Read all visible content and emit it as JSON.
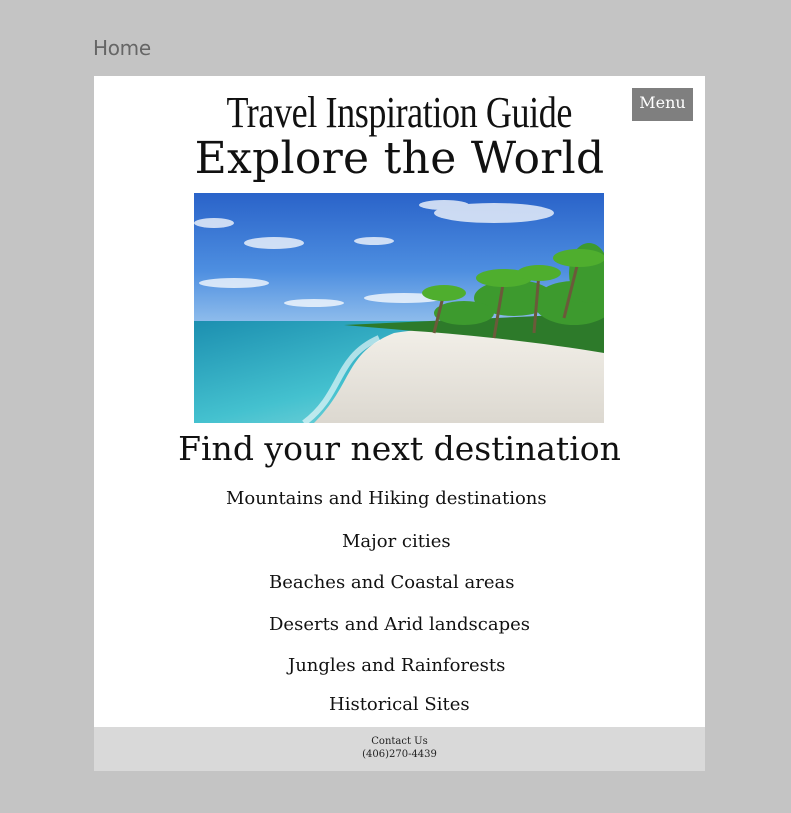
{
  "frame": {
    "label": "Home"
  },
  "header": {
    "site_title": "Travel Inspiration Guide",
    "menu_label": "Menu"
  },
  "hero": {
    "title": "Explore the World",
    "image_desc": "tropical beach with palm trees"
  },
  "destinations": {
    "heading": "Find your next destination",
    "items": [
      "Mountains and Hiking destinations",
      "Major cities",
      "Beaches and Coastal areas",
      "Deserts and Arid landscapes",
      "Jungles and Rainforests",
      "Historical Sites"
    ]
  },
  "footer": {
    "contact_label": "Contact Us",
    "phone": "(406)270-4439"
  },
  "colors": {
    "background": "#c4c4c4",
    "page": "#ffffff",
    "menu_button": "#7f7f7f",
    "footer": "#d9d9d9",
    "frame_label": "#666666"
  }
}
